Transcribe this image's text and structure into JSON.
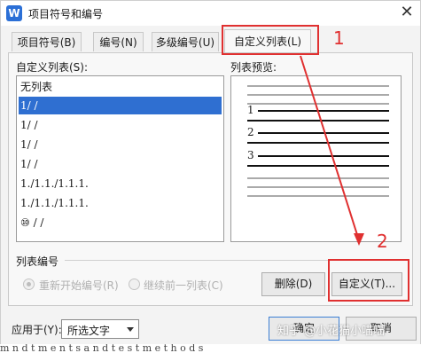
{
  "window": {
    "title": "项目符号和编号",
    "app_icon_letter": "W",
    "close_label": "✕"
  },
  "tabs": [
    {
      "label": "项目符号(B)"
    },
    {
      "label": "编号(N)"
    },
    {
      "label": "多级编号(U)"
    },
    {
      "label": "自定义列表(L)"
    }
  ],
  "custom_list": {
    "label": "自定义列表(S):",
    "items": [
      "无列表",
      "1/  /",
      "1/  /",
      "1/  /",
      "1/  /",
      "1./1.1./1.1.1.",
      "1./1.1./1.1.1.",
      "⑩   /   /"
    ],
    "selected_index": 1
  },
  "preview": {
    "label": "列表预览:",
    "numbers": [
      "1",
      "2",
      "3"
    ]
  },
  "numbering": {
    "group_label": "列表编号",
    "restart_label": "重新开始编号(R)",
    "continue_label": "继续前一列表(C)"
  },
  "buttons": {
    "delete": "删除(D)",
    "customize": "自定义(T)...",
    "ok": "确定",
    "cancel": "取消"
  },
  "apply_to": {
    "label": "应用于(Y):",
    "value": "所选文字"
  },
  "annotations": {
    "one": "1",
    "two": "2",
    "color": "#e03030"
  },
  "watermark": "知乎 @小花猫小喵喵",
  "background_text": "m n d  t m e n t s  a n d  t e s t  m e t h o d s"
}
